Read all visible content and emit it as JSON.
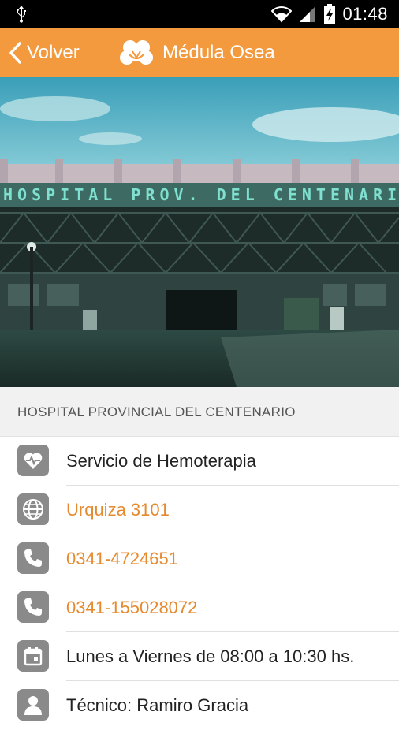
{
  "status_bar": {
    "time": "01:48",
    "icons": [
      "usb-icon",
      "wifi-icon",
      "signal-icon",
      "battery-charging-icon"
    ]
  },
  "app_bar": {
    "back_label": "Volver",
    "title": "Médula Osea",
    "logo_icon": "flower-hand-icon",
    "background_color": "#f39a3e"
  },
  "hero": {
    "sign_text": "HOSPITAL PROV. DEL CENTENARIO"
  },
  "section": {
    "title": "HOSPITAL PROVINCIAL DEL CENTENARIO"
  },
  "details": [
    {
      "icon": "heart-pulse-icon",
      "text": "Servicio de Hemoterapia",
      "link": false
    },
    {
      "icon": "globe-icon",
      "text": "Urquiza 3101",
      "link": true
    },
    {
      "icon": "phone-icon",
      "text": "0341-4724651",
      "link": true
    },
    {
      "icon": "phone-icon",
      "text": "0341-155028072",
      "link": true
    },
    {
      "icon": "calendar-icon",
      "text": "Lunes a Viernes de 08:00 a 10:30 hs.",
      "link": false
    },
    {
      "icon": "person-icon",
      "text": "Técnico: Ramiro Gracia",
      "link": false
    }
  ],
  "colors": {
    "accent": "#f39a3e",
    "link": "#e58a2f",
    "icon_bg": "#8a8a8a"
  }
}
